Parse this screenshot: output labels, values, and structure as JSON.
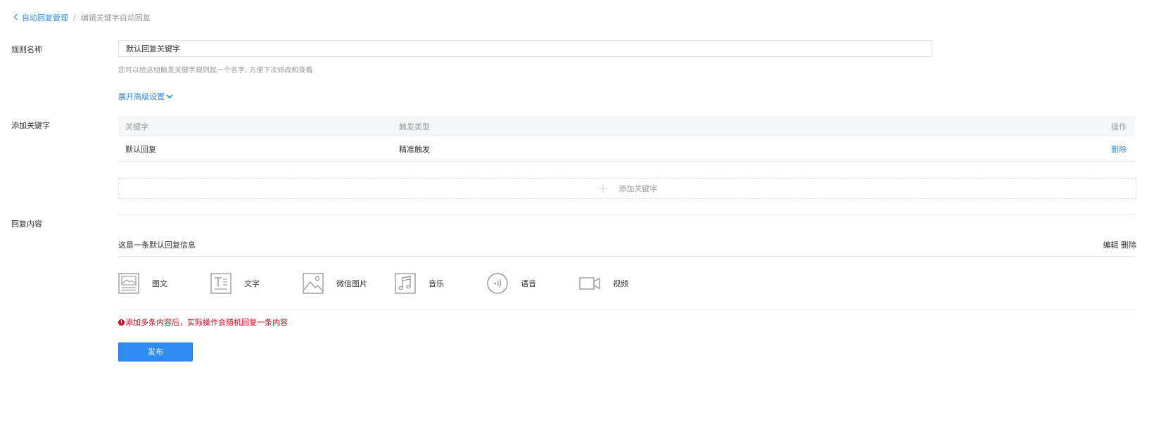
{
  "breadcrumb": {
    "back_icon": "chevron-left-icon",
    "parent": "自动回复管理",
    "separator": "/",
    "current": "编辑关键字自动回复"
  },
  "rule_name": {
    "label": "规则名称",
    "value": "默认回复关键字",
    "hint": "您可以给这组触发关键字规则起一个名字, 方便下次修改和查看."
  },
  "advanced_settings": {
    "label": "展开高级设置",
    "icon": "chevron-down-icon"
  },
  "keywords": {
    "label": "添加关键字",
    "columns": [
      "关键字",
      "触发类型",
      "操作"
    ],
    "rows": [
      {
        "keyword": "默认回复",
        "trigger_type": "精准触发",
        "action": "删除"
      }
    ],
    "add_label": "添加关键字"
  },
  "reply": {
    "label": "回复内容",
    "message": "这是一条默认回复信息",
    "edit_label": "编辑",
    "delete_label": "删除",
    "types": [
      {
        "label": "图文",
        "icon": "news-icon"
      },
      {
        "label": "文字",
        "icon": "text-icon"
      },
      {
        "label": "微信图片",
        "icon": "image-icon"
      },
      {
        "label": "音乐",
        "icon": "music-icon"
      },
      {
        "label": "语音",
        "icon": "voice-icon"
      },
      {
        "label": "视频",
        "icon": "video-icon"
      }
    ],
    "warning_icon": "!",
    "warning": "添加多条内容后，实际操作会随机回复一条内容"
  },
  "publish_label": "发布",
  "colors": {
    "primary": "#2d8cf0",
    "warning": "#d0021b",
    "muted": "#999999",
    "border": "#e8e8e8"
  }
}
